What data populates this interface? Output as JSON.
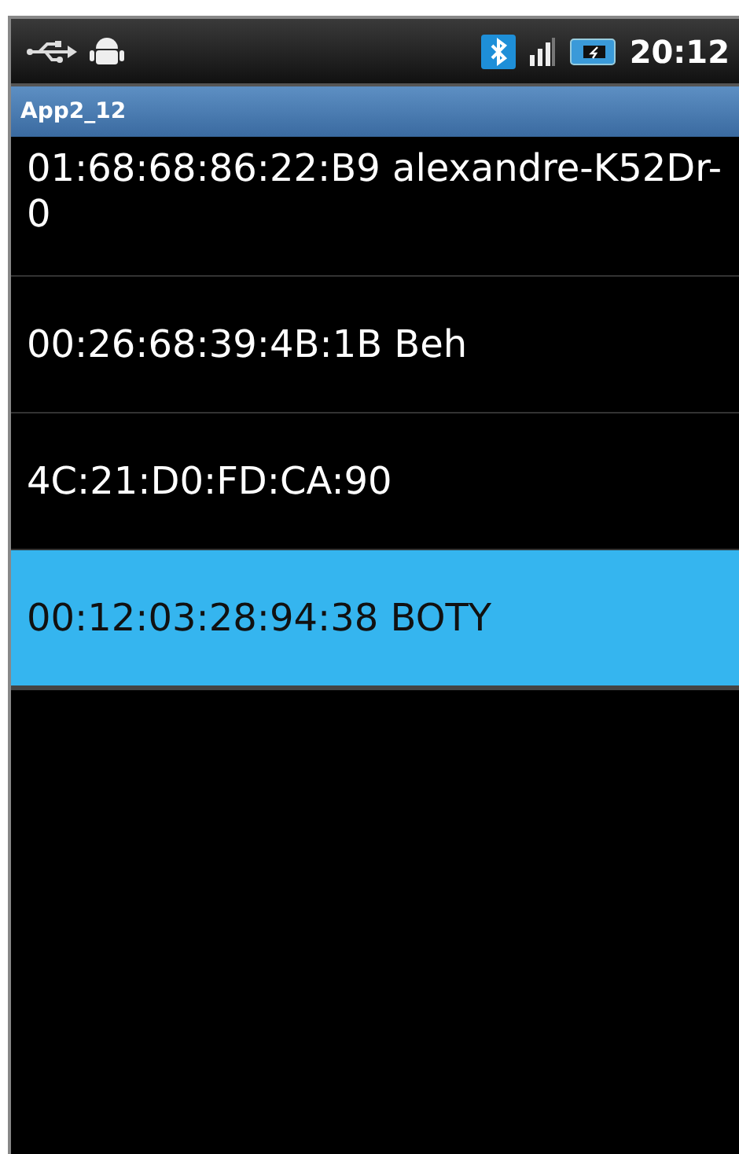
{
  "status_bar": {
    "time": "20:12"
  },
  "title_bar": {
    "title": "App2_12"
  },
  "devices": [
    {
      "label": "01:68:68:86:22:B9 alexandre-K52Dr-0",
      "selected": false
    },
    {
      "label": "00:26:68:39:4B:1B Beh",
      "selected": false
    },
    {
      "label": "4C:21:D0:FD:CA:90",
      "selected": false
    },
    {
      "label": "00:12:03:28:94:38 BOTY",
      "selected": true
    }
  ]
}
